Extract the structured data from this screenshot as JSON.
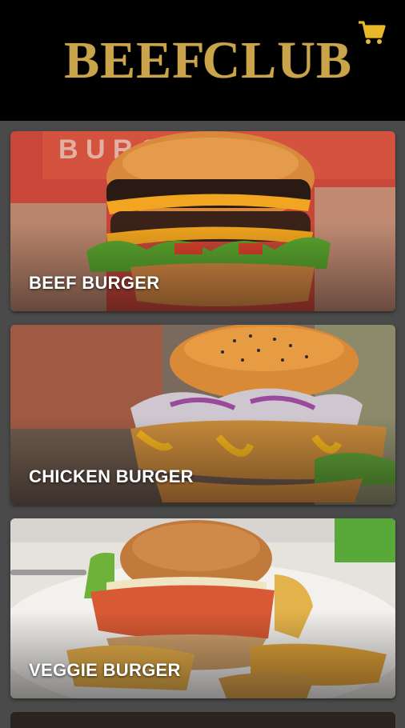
{
  "header": {
    "brand_left": "BEEF",
    "brand_right": "CLUB",
    "cart_icon": "shopping-cart-icon",
    "accent_color": "#e8b82a"
  },
  "menu": {
    "items": [
      {
        "label": "BEEF BURGER"
      },
      {
        "label": "CHICKEN BURGER"
      },
      {
        "label": "VEGGIE BURGER"
      }
    ]
  }
}
